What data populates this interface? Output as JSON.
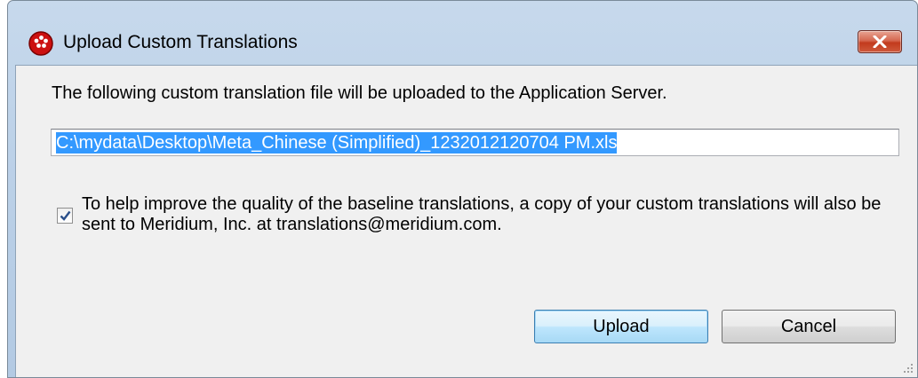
{
  "window": {
    "title": "Upload Custom Translations",
    "app_icon": "meridium-red-dot-icon",
    "close_icon": "close-x-icon"
  },
  "dialog": {
    "message": "The following custom translation file will be uploaded to the Application Server.",
    "file_path": "C:\\mydata\\Desktop\\Meta_Chinese (Simplified)_1232012120704 PM.xls",
    "share_checkbox": {
      "checked": true,
      "label": "To help improve the quality of the baseline translations, a copy of your custom translations will also be sent to Meridium, Inc. at translations@meridium.com."
    }
  },
  "buttons": {
    "upload_label": "Upload",
    "cancel_label": "Cancel"
  },
  "colors": {
    "title_bar": "#bcd1e8",
    "close_button": "#c9482a",
    "selection": "#3399ff",
    "dialog_bg": "#f0f0f0"
  }
}
